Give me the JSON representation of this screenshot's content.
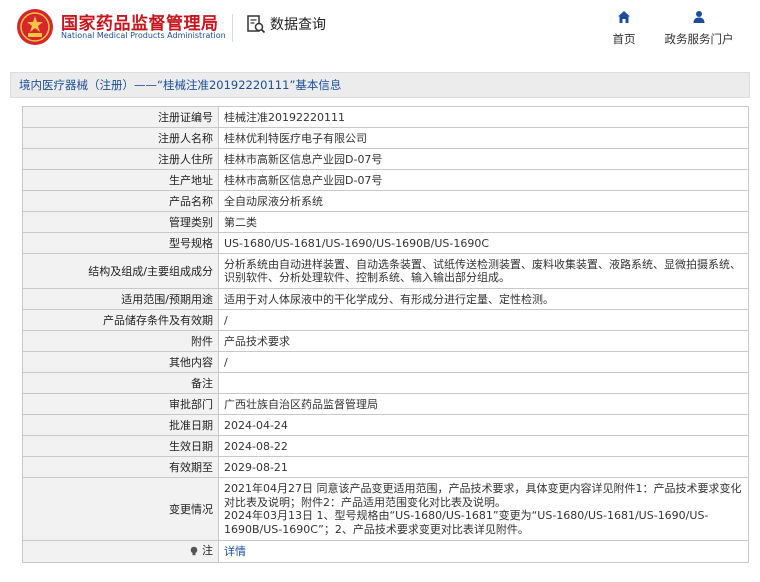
{
  "header": {
    "brand_cn": "国家药品监督管理局",
    "brand_en": "National Medical Products Administration",
    "data_query": "数据查询",
    "nav": [
      {
        "label": "首页",
        "icon": "home-icon"
      },
      {
        "label": "政务服务门户",
        "icon": "user-icon"
      }
    ]
  },
  "title_bar": "境内医疗器械（注册）——“桂械注准20192220111”基本信息",
  "rows": [
    {
      "label": "注册证编号",
      "value": "桂械注准20192220111"
    },
    {
      "label": "注册人名称",
      "value": "桂林优利特医疗电子有限公司"
    },
    {
      "label": "注册人住所",
      "value": "桂林市高新区信息产业园D-07号"
    },
    {
      "label": "生产地址",
      "value": "桂林市高新区信息产业园D-07号"
    },
    {
      "label": "产品名称",
      "value": "全自动尿液分析系统"
    },
    {
      "label": "管理类别",
      "value": "第二类"
    },
    {
      "label": "型号规格",
      "value": "US-1680/US-1681/US-1690/US-1690B/US-1690C"
    },
    {
      "label": "结构及组成/主要组成成分",
      "value": "分析系统由自动进样装置、自动选条装置、试纸传送检测装置、废料收集装置、液路系统、显微拍摄系统、识别软件、分析处理软件、控制系统、输入输出部分组成。"
    },
    {
      "label": "适用范围/预期用途",
      "value": "适用于对人体尿液中的干化学成分、有形成分进行定量、定性检测。"
    },
    {
      "label": "产品储存条件及有效期",
      "value": "/"
    },
    {
      "label": "附件",
      "value": "产品技术要求"
    },
    {
      "label": "其他内容",
      "value": "/"
    },
    {
      "label": "备注",
      "value": ""
    },
    {
      "label": "审批部门",
      "value": "广西壮族自治区药品监督管理局"
    },
    {
      "label": "批准日期",
      "value": "2024-04-24"
    },
    {
      "label": "生效日期",
      "value": "2024-08-22"
    },
    {
      "label": "有效期至",
      "value": "2029-08-21"
    },
    {
      "label": "变更情况",
      "value_lines": [
        "2021年04月27日 同意该产品变更适用范围，产品技术要求，具体变更内容详见附件1：产品技术要求变化对比表及说明；附件2：产品适用范围变化对比表及说明。",
        "2024年03月13日 1、型号规格由“US-1680/US-1681”变更为“US-1680/US-1681/US-1690/US-1690B/US-1690C”；2、产品技术要求变更对比表详见附件。"
      ]
    },
    {
      "label": "注",
      "value": "详情",
      "icon": "lightbulb-icon"
    }
  ],
  "colors": {
    "brand_red": "#c8161d",
    "brand_blue": "#1a4e9a",
    "label_bg": "#f2f2f2"
  }
}
